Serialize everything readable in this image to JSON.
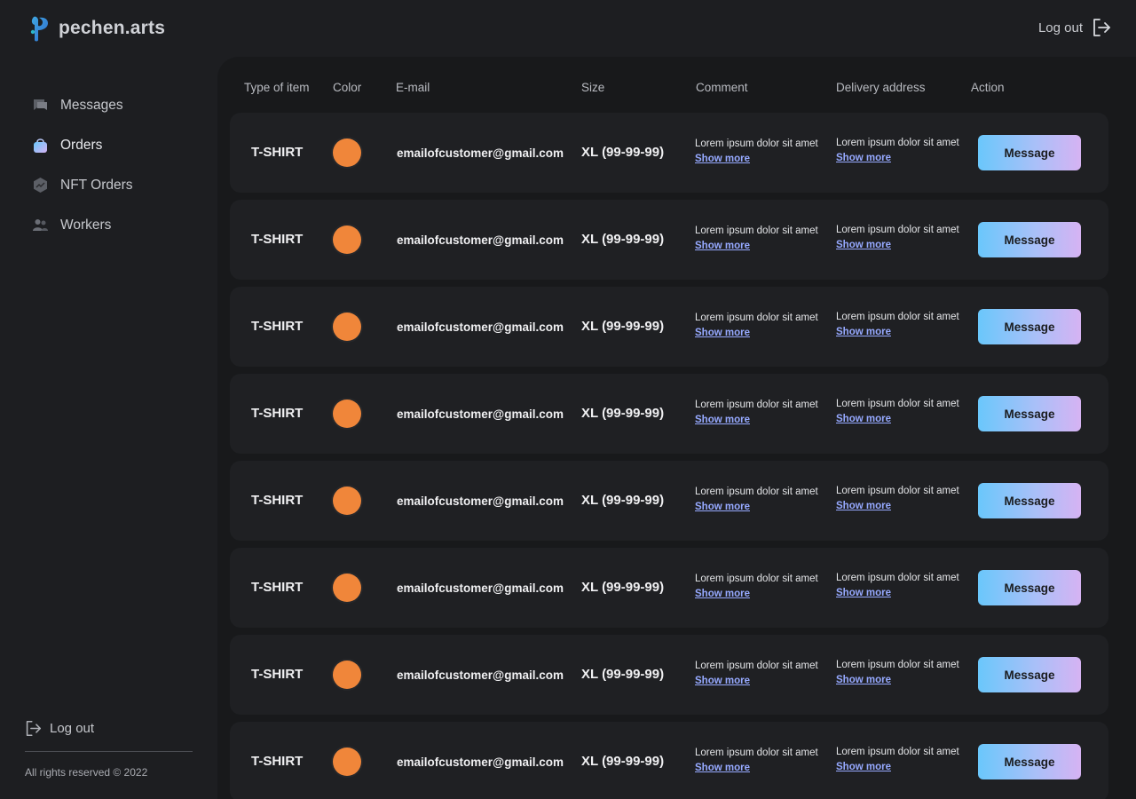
{
  "brand": {
    "name": "pechen.arts"
  },
  "header": {
    "logout_label": "Log out"
  },
  "sidebar": {
    "items": [
      {
        "label": "Messages",
        "icon": "chat-icon",
        "active": false
      },
      {
        "label": "Orders",
        "icon": "shopping-bag-icon",
        "active": true
      },
      {
        "label": "NFT Orders",
        "icon": "nft-hexagon-icon",
        "active": false
      },
      {
        "label": "Workers",
        "icon": "users-icon",
        "active": false
      }
    ],
    "logout_label": "Log out",
    "copyright": "All rights reserved © 2022"
  },
  "colors": {
    "background": "#1d1e21",
    "panel": "#18191b",
    "row": "#1f2023",
    "swatch": "#f0863a",
    "link": "#96a9ff",
    "button_gradient": [
      "#6ac7fb",
      "#d6b3f3"
    ]
  },
  "table": {
    "columns": [
      "Type of item",
      "Color",
      "E-mail",
      "Size",
      "Comment",
      "Delivery address",
      "Action"
    ],
    "rows": [
      {
        "type": "T-SHIRT",
        "color": "#f0863a",
        "email": "emailofcustomer@gmail.com",
        "size": "XL (99-99-99)",
        "comment": "Lorem ipsum dolor sit amet",
        "comment_more": "Show more",
        "address": "Lorem ipsum dolor sit amet",
        "address_more": "Show more",
        "action": "Message"
      },
      {
        "type": "T-SHIRT",
        "color": "#f0863a",
        "email": "emailofcustomer@gmail.com",
        "size": "XL (99-99-99)",
        "comment": "Lorem ipsum dolor sit amet",
        "comment_more": "Show more",
        "address": "Lorem ipsum dolor sit amet",
        "address_more": "Show more",
        "action": "Message"
      },
      {
        "type": "T-SHIRT",
        "color": "#f0863a",
        "email": "emailofcustomer@gmail.com",
        "size": "XL (99-99-99)",
        "comment": "Lorem ipsum dolor sit amet",
        "comment_more": "Show more",
        "address": "Lorem ipsum dolor sit amet",
        "address_more": "Show more",
        "action": "Message"
      },
      {
        "type": "T-SHIRT",
        "color": "#f0863a",
        "email": "emailofcustomer@gmail.com",
        "size": "XL (99-99-99)",
        "comment": "Lorem ipsum dolor sit amet",
        "comment_more": "Show more",
        "address": "Lorem ipsum dolor sit amet",
        "address_more": "Show more",
        "action": "Message"
      },
      {
        "type": "T-SHIRT",
        "color": "#f0863a",
        "email": "emailofcustomer@gmail.com",
        "size": "XL (99-99-99)",
        "comment": "Lorem ipsum dolor sit amet",
        "comment_more": "Show more",
        "address": "Lorem ipsum dolor sit amet",
        "address_more": "Show more",
        "action": "Message"
      },
      {
        "type": "T-SHIRT",
        "color": "#f0863a",
        "email": "emailofcustomer@gmail.com",
        "size": "XL (99-99-99)",
        "comment": "Lorem ipsum dolor sit amet",
        "comment_more": "Show more",
        "address": "Lorem ipsum dolor sit amet",
        "address_more": "Show more",
        "action": "Message"
      },
      {
        "type": "T-SHIRT",
        "color": "#f0863a",
        "email": "emailofcustomer@gmail.com",
        "size": "XL (99-99-99)",
        "comment": "Lorem ipsum dolor sit amet",
        "comment_more": "Show more",
        "address": "Lorem ipsum dolor sit amet",
        "address_more": "Show more",
        "action": "Message"
      },
      {
        "type": "T-SHIRT",
        "color": "#f0863a",
        "email": "emailofcustomer@gmail.com",
        "size": "XL (99-99-99)",
        "comment": "Lorem ipsum dolor sit amet",
        "comment_more": "Show more",
        "address": "Lorem ipsum dolor sit amet",
        "address_more": "Show more",
        "action": "Message"
      }
    ]
  }
}
